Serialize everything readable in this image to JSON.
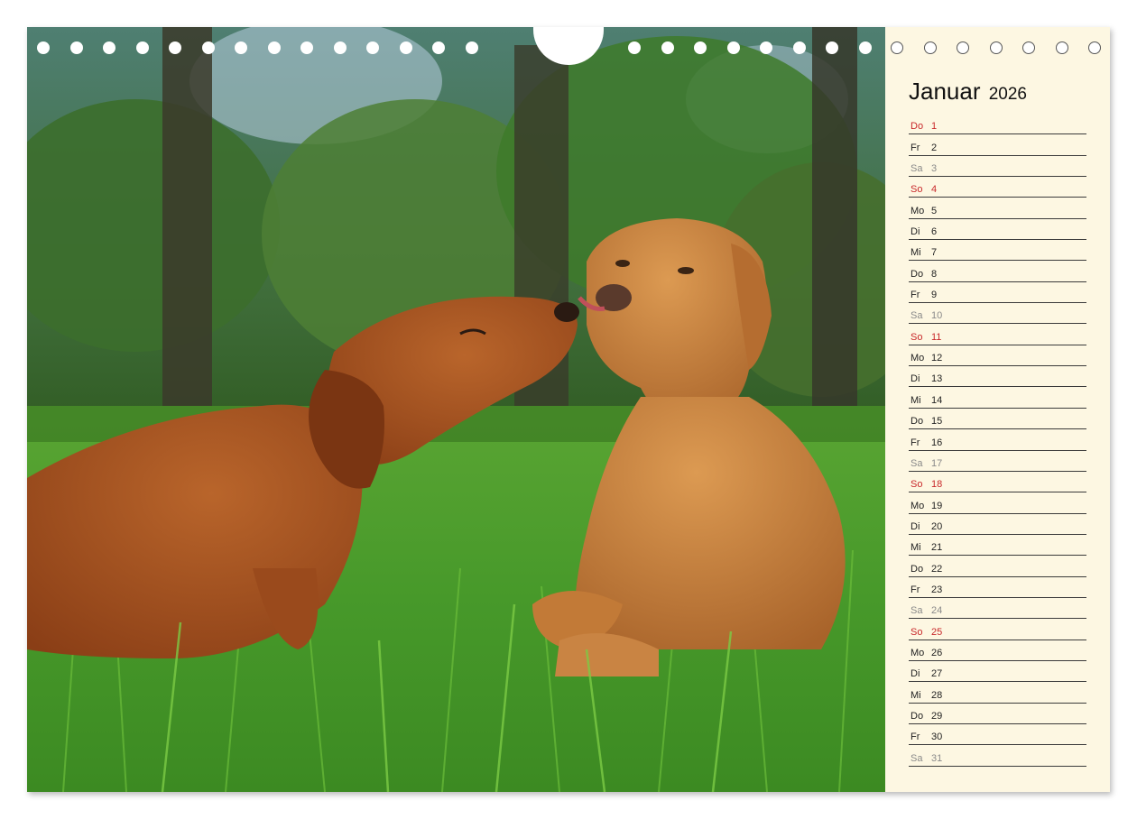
{
  "calendar": {
    "month": "Januar",
    "year": "2026",
    "days": [
      {
        "wd": "Do",
        "d": "1",
        "type": "holiday"
      },
      {
        "wd": "Fr",
        "d": "2",
        "type": "weekday"
      },
      {
        "wd": "Sa",
        "d": "3",
        "type": "sat"
      },
      {
        "wd": "So",
        "d": "4",
        "type": "sun"
      },
      {
        "wd": "Mo",
        "d": "5",
        "type": "weekday"
      },
      {
        "wd": "Di",
        "d": "6",
        "type": "weekday"
      },
      {
        "wd": "Mi",
        "d": "7",
        "type": "weekday"
      },
      {
        "wd": "Do",
        "d": "8",
        "type": "weekday"
      },
      {
        "wd": "Fr",
        "d": "9",
        "type": "weekday"
      },
      {
        "wd": "Sa",
        "d": "10",
        "type": "sat"
      },
      {
        "wd": "So",
        "d": "11",
        "type": "sun"
      },
      {
        "wd": "Mo",
        "d": "12",
        "type": "weekday"
      },
      {
        "wd": "Di",
        "d": "13",
        "type": "weekday"
      },
      {
        "wd": "Mi",
        "d": "14",
        "type": "weekday"
      },
      {
        "wd": "Do",
        "d": "15",
        "type": "weekday"
      },
      {
        "wd": "Fr",
        "d": "16",
        "type": "weekday"
      },
      {
        "wd": "Sa",
        "d": "17",
        "type": "sat"
      },
      {
        "wd": "So",
        "d": "18",
        "type": "sun"
      },
      {
        "wd": "Mo",
        "d": "19",
        "type": "weekday"
      },
      {
        "wd": "Di",
        "d": "20",
        "type": "weekday"
      },
      {
        "wd": "Mi",
        "d": "21",
        "type": "weekday"
      },
      {
        "wd": "Do",
        "d": "22",
        "type": "weekday"
      },
      {
        "wd": "Fr",
        "d": "23",
        "type": "weekday"
      },
      {
        "wd": "Sa",
        "d": "24",
        "type": "sat"
      },
      {
        "wd": "So",
        "d": "25",
        "type": "sun"
      },
      {
        "wd": "Mo",
        "d": "26",
        "type": "weekday"
      },
      {
        "wd": "Di",
        "d": "27",
        "type": "weekday"
      },
      {
        "wd": "Mi",
        "d": "28",
        "type": "weekday"
      },
      {
        "wd": "Do",
        "d": "29",
        "type": "weekday"
      },
      {
        "wd": "Fr",
        "d": "30",
        "type": "weekday"
      },
      {
        "wd": "Sa",
        "d": "31",
        "type": "sat"
      }
    ]
  },
  "colors": {
    "paper": "#fdf7e2",
    "sunday": "#c8282b",
    "saturday": "#8a8a8a",
    "grass": "#3f9a22",
    "dog_left": "#a8521f",
    "dog_right": "#c8843f"
  },
  "photo": {
    "subject": "two-dogs-in-grass-photo"
  }
}
